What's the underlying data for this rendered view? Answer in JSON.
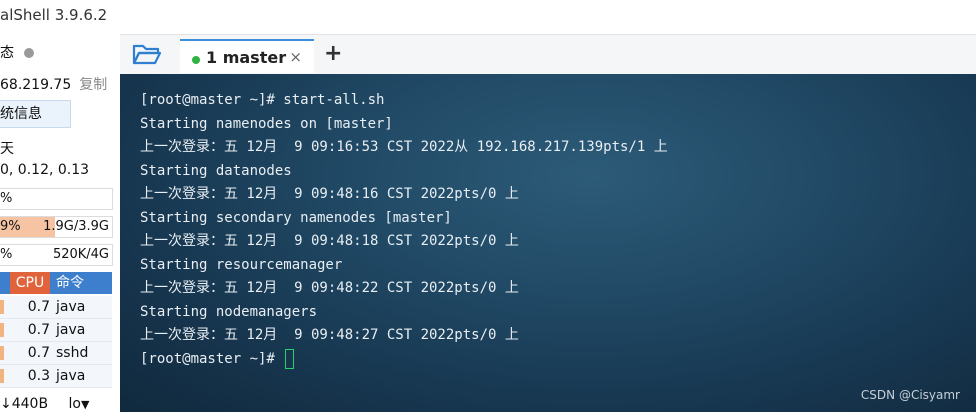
{
  "app": {
    "title": "alShell 3.9.6.2"
  },
  "left_panel": {
    "status_label": "态",
    "ip": "68.219.75",
    "copy_label": "复制",
    "sysinfo_label": "统信息",
    "uptime": "天",
    "load": "0, 0.12, 0.13",
    "cpu_meter": {
      "left": "%",
      "right": ""
    },
    "mem_meter": {
      "left": "9%",
      "right": "1.9G/3.9G",
      "fraction": 0.49
    },
    "swap_meter": {
      "left": "%",
      "right": "520K/4G"
    },
    "process_table": {
      "headers": {
        "cpu": "CPU",
        "command": "命令"
      },
      "rows": [
        {
          "cpu": "0.7",
          "command": "java"
        },
        {
          "cpu": "0.7",
          "command": "java"
        },
        {
          "cpu": "0.7",
          "command": "sshd"
        },
        {
          "cpu": "0.3",
          "command": "java"
        }
      ]
    },
    "net": {
      "down": "↓440B",
      "iface": "lo"
    }
  },
  "tabs": {
    "active": {
      "label": "1 master",
      "close": "×"
    },
    "add_label": "+",
    "folder_icon": "folder-open-icon"
  },
  "terminal": {
    "lines": [
      "[root@master ~]# start-all.sh",
      "Starting namenodes on [master]",
      "上一次登录：五 12月  9 09:16:53 CST 2022从 192.168.217.139pts/1 上",
      "Starting datanodes",
      "上一次登录：五 12月  9 09:48:16 CST 2022pts/0 上",
      "Starting secondary namenodes [master]",
      "上一次登录：五 12月  9 09:48:18 CST 2022pts/0 上",
      "Starting resourcemanager",
      "上一次登录：五 12月  9 09:48:22 CST 2022pts/0 上",
      "Starting nodemanagers",
      "上一次登录：五 12月  9 09:48:27 CST 2022pts/0 上",
      "[root@master ~]# "
    ],
    "watermark": "CSDN @Cisyamr"
  },
  "colors": {
    "accent": "#3d8fdb",
    "tab_dot": "#2fb344",
    "cpu_header": "#e0633c",
    "cursor": "#2ad06a"
  }
}
